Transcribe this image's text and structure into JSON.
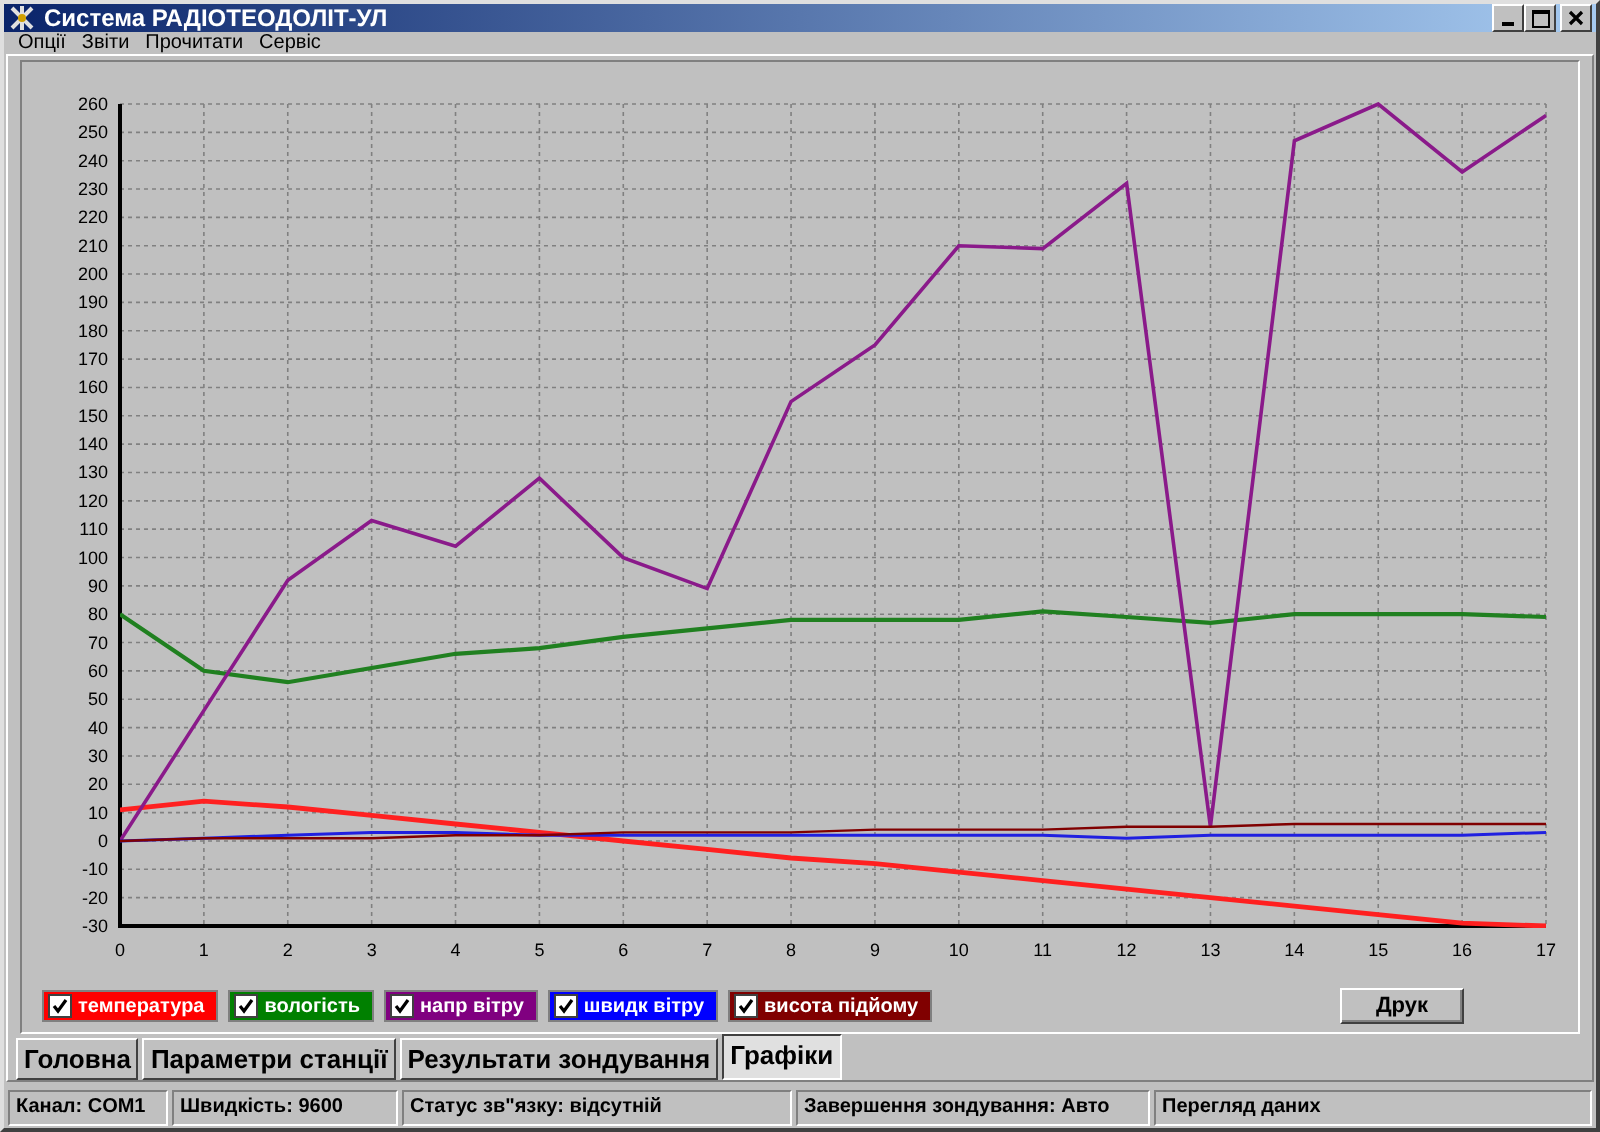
{
  "window": {
    "title": "Система РАДІОТЕОДОЛІТ-УЛ"
  },
  "menu": [
    "Опції",
    "Звіти",
    "Прочитати",
    "Сервіс"
  ],
  "chart": {
    "chart_data": {
      "type": "line",
      "x": [
        0,
        1,
        2,
        3,
        4,
        5,
        6,
        7,
        8,
        9,
        10,
        11,
        12,
        13,
        14,
        15,
        16,
        17
      ],
      "xlim": [
        0,
        17
      ],
      "ylim": [
        -30,
        260
      ],
      "grid": true,
      "xticks": [
        0,
        1,
        2,
        3,
        4,
        5,
        6,
        7,
        8,
        9,
        10,
        11,
        12,
        13,
        14,
        15,
        16,
        17
      ],
      "yticks": [
        -30,
        -20,
        -10,
        0,
        10,
        20,
        30,
        40,
        50,
        60,
        70,
        80,
        90,
        100,
        110,
        120,
        130,
        140,
        150,
        160,
        170,
        180,
        190,
        200,
        210,
        220,
        230,
        240,
        250,
        260
      ],
      "series": [
        {
          "name": "температура",
          "color": "#ff2020",
          "values": [
            11,
            14,
            12,
            9,
            6,
            3,
            0,
            -3,
            -6,
            -8,
            -11,
            -14,
            -17,
            -20,
            -23,
            -26,
            -29,
            -30
          ]
        },
        {
          "name": "вологість",
          "color": "#208020",
          "values": [
            80,
            60,
            56,
            61,
            66,
            68,
            72,
            75,
            78,
            78,
            78,
            81,
            79,
            77,
            80,
            80,
            80,
            79
          ]
        },
        {
          "name": "напр вітру",
          "color": "#8a1a8a",
          "values": [
            0,
            46,
            92,
            113,
            104,
            128,
            100,
            89,
            155,
            175,
            210,
            209,
            232,
            5,
            247,
            260,
            236,
            256
          ]
        },
        {
          "name": "швидк вітру",
          "color": "#2020e0",
          "values": [
            0,
            1,
            2,
            3,
            3,
            2,
            2,
            2,
            2,
            2,
            2,
            2,
            1,
            2,
            2,
            2,
            2,
            3
          ]
        },
        {
          "name": "висота підйому",
          "color": "#800000",
          "values": [
            0,
            1,
            1,
            1,
            2,
            2,
            3,
            3,
            3,
            4,
            4,
            4,
            5,
            5,
            6,
            6,
            6,
            6
          ]
        }
      ]
    }
  },
  "legend": [
    {
      "checked": true,
      "color": "#ff0000"
    },
    {
      "checked": true,
      "color": "#008000"
    },
    {
      "checked": true,
      "color": "#800080"
    },
    {
      "checked": true,
      "color": "#0000ff"
    },
    {
      "checked": true,
      "color": "#800000"
    }
  ],
  "print_button": "Друк",
  "tabs": [
    {
      "label": "Головна",
      "selected": false
    },
    {
      "label": "Параметри станції",
      "selected": false
    },
    {
      "label": "Результати зондування",
      "selected": false
    },
    {
      "label": "Графіки",
      "selected": true
    }
  ],
  "status_bar": [
    "Канал: COM1",
    "Швидкість: 9600",
    "Статус зв\"язку:  відсутній",
    "Завершення зондування: Авто",
    "Перегляд даних"
  ]
}
